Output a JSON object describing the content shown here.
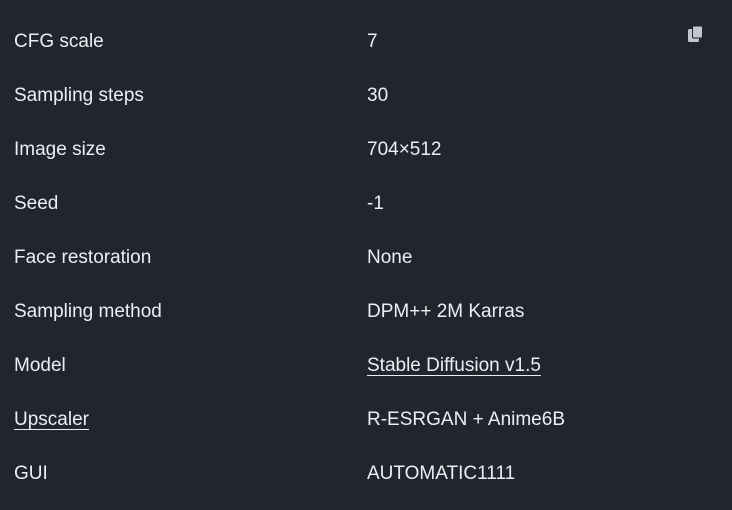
{
  "icons": {
    "copy": "copy-icon"
  },
  "colors": {
    "background": "#22252c",
    "text": "#eceef2",
    "icon": "#c4c7ce"
  },
  "rows": [
    {
      "label": "CFG scale",
      "value": "7"
    },
    {
      "label": "Sampling steps",
      "value": "30"
    },
    {
      "label": "Image size",
      "value": "704×512"
    },
    {
      "label": "Seed",
      "value": "-1"
    },
    {
      "label": "Face restoration",
      "value": "None"
    },
    {
      "label": "Sampling method",
      "value": "DPM++ 2M Karras"
    },
    {
      "label": "Model",
      "value": "Stable Diffusion v1.5"
    },
    {
      "label": "Upscaler",
      "value": "R-ESRGAN + Anime6B"
    },
    {
      "label": "GUI",
      "value": "AUTOMATIC1111"
    }
  ]
}
